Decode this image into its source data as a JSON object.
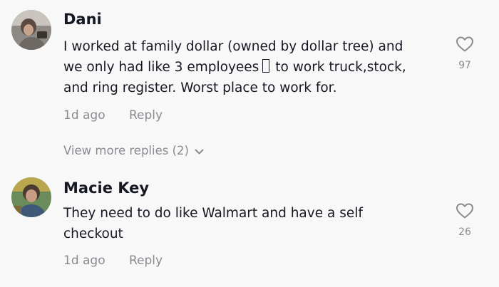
{
  "comments": [
    {
      "username": "Dani",
      "text_lines": [
        "I worked at family dollar (owned by dollar tree) and",
        "we only had like 3 employees",
        "to work truck,stock,",
        "and ring register. Worst place to work for."
      ],
      "time": "1d ago",
      "reply_label": "Reply",
      "likes": "97",
      "view_more": "View more replies (2)"
    },
    {
      "username": "Macie Key",
      "text_lines": [
        "They need to do like Walmart and have a self",
        "checkout"
      ],
      "time": "1d ago",
      "reply_label": "Reply",
      "likes": "26"
    }
  ],
  "icons": {
    "like": "heart-outline-icon",
    "expand": "chevron-down-icon",
    "missing_glyph": "missing-emoji-box"
  },
  "colors": {
    "background": "#f8f8f8",
    "primary_text": "#161823",
    "secondary_text": "#8a8b91"
  }
}
